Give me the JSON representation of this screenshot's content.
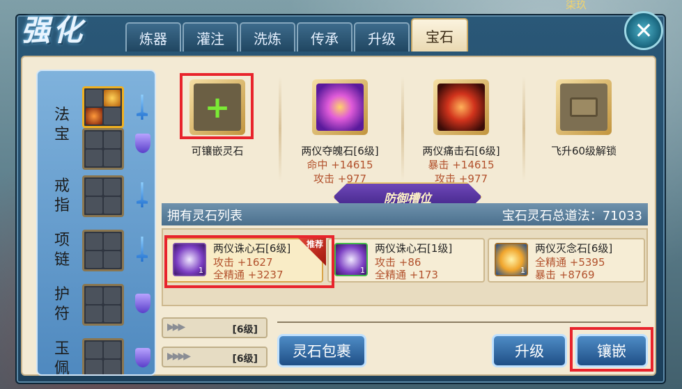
{
  "top_label": "柒玖",
  "title": "强化",
  "tabs": [
    {
      "label": "炼器",
      "active": false
    },
    {
      "label": "灌注",
      "active": false
    },
    {
      "label": "洗炼",
      "active": false
    },
    {
      "label": "传承",
      "active": false
    },
    {
      "label": "升级",
      "active": false
    },
    {
      "label": "宝石",
      "active": true
    }
  ],
  "equipment": [
    {
      "label": "法宝"
    },
    {
      "label": "戒指"
    },
    {
      "label": "项链"
    },
    {
      "label": "护符"
    },
    {
      "label": "玉佩"
    }
  ],
  "slots": [
    {
      "name": "可镶嵌灵石",
      "stat1": "",
      "stat2": "",
      "state": "empty"
    },
    {
      "name": "两仪夺魄石[6级]",
      "stat1": "命中 +14615",
      "stat2": "攻击 +977",
      "state": "purple"
    },
    {
      "name": "两仪痛击石[6级]",
      "stat1": "暴击 +14615",
      "stat2": "攻击 +977",
      "state": "red"
    },
    {
      "name": "飞升60级解锁",
      "stat1": "",
      "stat2": "",
      "state": "locked"
    }
  ],
  "slot_ribbon": "防御槽位",
  "list": {
    "title": "拥有灵石列表",
    "total": "宝石灵石总道法：71033"
  },
  "stones": [
    {
      "name": "两仪诛心石[6级]",
      "stat1": "攻击 +1627",
      "stat2": "全精通 +3237",
      "count": "1",
      "badge": "推荐"
    },
    {
      "name": "两仪诛心石[1级]",
      "stat1": "攻击 +86",
      "stat2": "全精通 +173",
      "count": "1",
      "badge": ""
    },
    {
      "name": "两仪灭念石[6级]",
      "stat1": "全精通 +5395",
      "stat2": "暴击 +8769",
      "count": "1",
      "badge": ""
    }
  ],
  "pagers": [
    {
      "level": "[6级]"
    },
    {
      "level": "[6级]"
    }
  ],
  "buttons": {
    "bag": "灵石包裹",
    "upgrade": "升级",
    "inlay": "镶嵌"
  },
  "colors": {
    "highlight": "#e8242c",
    "stat_text": "#b2512c"
  }
}
